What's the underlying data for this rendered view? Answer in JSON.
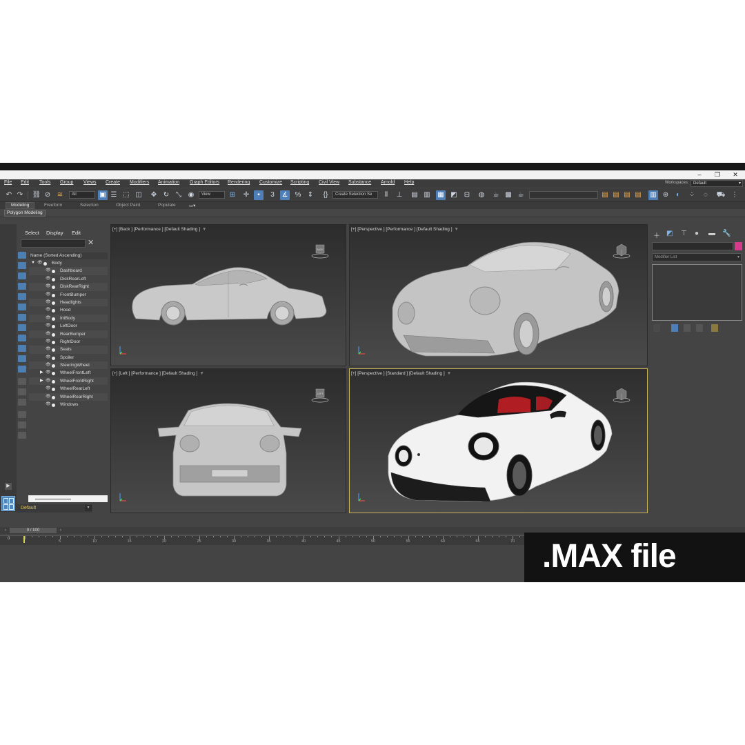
{
  "window": {
    "minimize": "–",
    "maximize": "❐",
    "close": "✕"
  },
  "menu": [
    "File",
    "Edit",
    "Tools",
    "Group",
    "Views",
    "Create",
    "Modifiers",
    "Animation",
    "Graph Editors",
    "Rendering",
    "Customize",
    "Scripting",
    "Civil View",
    "Substance",
    "Arnold",
    "Help"
  ],
  "workspace": {
    "label": "Workspaces:",
    "value": "Default"
  },
  "toolbar": {
    "filter": "All",
    "refcoord": "View",
    "named_selection": "Create Selection Se"
  },
  "ribbon": {
    "tabs": [
      "Modeling",
      "Freeform",
      "Selection",
      "Object Paint",
      "Populate"
    ],
    "active": "Modeling",
    "panel": "Polygon Modeling"
  },
  "explorer": {
    "tabs": [
      "Select",
      "Display",
      "Edit"
    ],
    "column_header": "Name (Sorted Ascending)",
    "root": "Body",
    "items": [
      {
        "name": "Dashboard",
        "expandable": false
      },
      {
        "name": "DiskRearLeft",
        "expandable": false
      },
      {
        "name": "DiskRearRight",
        "expandable": false
      },
      {
        "name": "FrontBumper",
        "expandable": false
      },
      {
        "name": "Headlights",
        "expandable": false
      },
      {
        "name": "Hood",
        "expandable": false
      },
      {
        "name": "IntBody",
        "expandable": false
      },
      {
        "name": "LeftDoor",
        "expandable": false
      },
      {
        "name": "RearBumper",
        "expandable": false
      },
      {
        "name": "RightDoor",
        "expandable": false
      },
      {
        "name": "Seats",
        "expandable": false
      },
      {
        "name": "Spoiler",
        "expandable": false
      },
      {
        "name": "SteeringWheel",
        "expandable": false
      },
      {
        "name": "WheelFrontLeft",
        "expandable": true
      },
      {
        "name": "WheelFrontRight",
        "expandable": true
      },
      {
        "name": "WheelRearLeft",
        "expandable": false
      },
      {
        "name": "WheelRearRight",
        "expandable": false
      },
      {
        "name": "Windows",
        "expandable": false
      }
    ],
    "layer": "Default"
  },
  "viewports": {
    "back": {
      "label": "[+] [Back ] [Performance ] [Default Shading ]",
      "cube": "BACK"
    },
    "persp_top": {
      "label": "[+] [Perspective ] [Performance ] [Default Shading ]"
    },
    "left": {
      "label": "[+] [Left ] [Performance ] [Default Shading ]",
      "cube": "LEFT"
    },
    "persp_bottom": {
      "label": "[+] [Perspective ] [Standard ] [Default Shading ]"
    }
  },
  "command_panel": {
    "modifier_list": "Modifier List",
    "object_color": "#d63a8a"
  },
  "timeline": {
    "frame": "0 / 100",
    "ticks": [
      "5",
      "10",
      "15",
      "20",
      "25",
      "30",
      "35",
      "40",
      "45",
      "50",
      "55",
      "60",
      "65",
      "70",
      "75"
    ],
    "start": "0"
  },
  "watermark": ".MAX file"
}
